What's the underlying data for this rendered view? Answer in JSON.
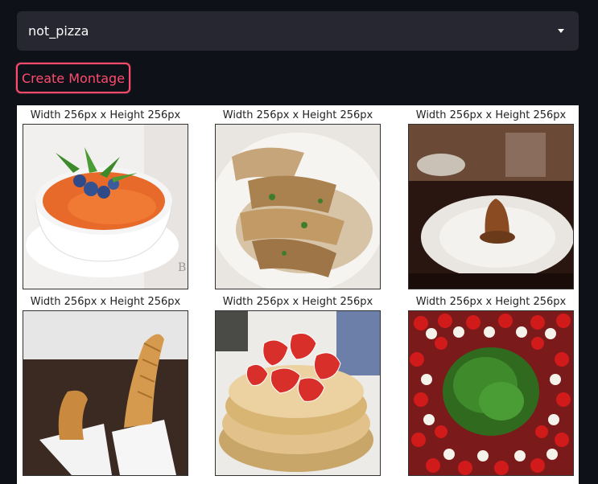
{
  "selector": {
    "value": "not_pizza",
    "icon": "chevron-down-icon"
  },
  "button": {
    "label": "Create Montage",
    "color": "#ff4b6e"
  },
  "montage": {
    "images": [
      {
        "caption": "Width 256px x Height 256px",
        "subject": "panna cotta with berries and mint"
      },
      {
        "caption": "Width 256px x Height 256px",
        "subject": "pan-fried dumplings"
      },
      {
        "caption": "Width 256px x Height 256px",
        "subject": "fried croquette on plate"
      },
      {
        "caption": "Width 256px x Height 256px",
        "subject": "churros in paper"
      },
      {
        "caption": "Width 256px x Height 256px",
        "subject": "pancakes with strawberries"
      },
      {
        "caption": "Width 256px x Height 256px",
        "subject": "caprese skewers platter"
      }
    ]
  }
}
